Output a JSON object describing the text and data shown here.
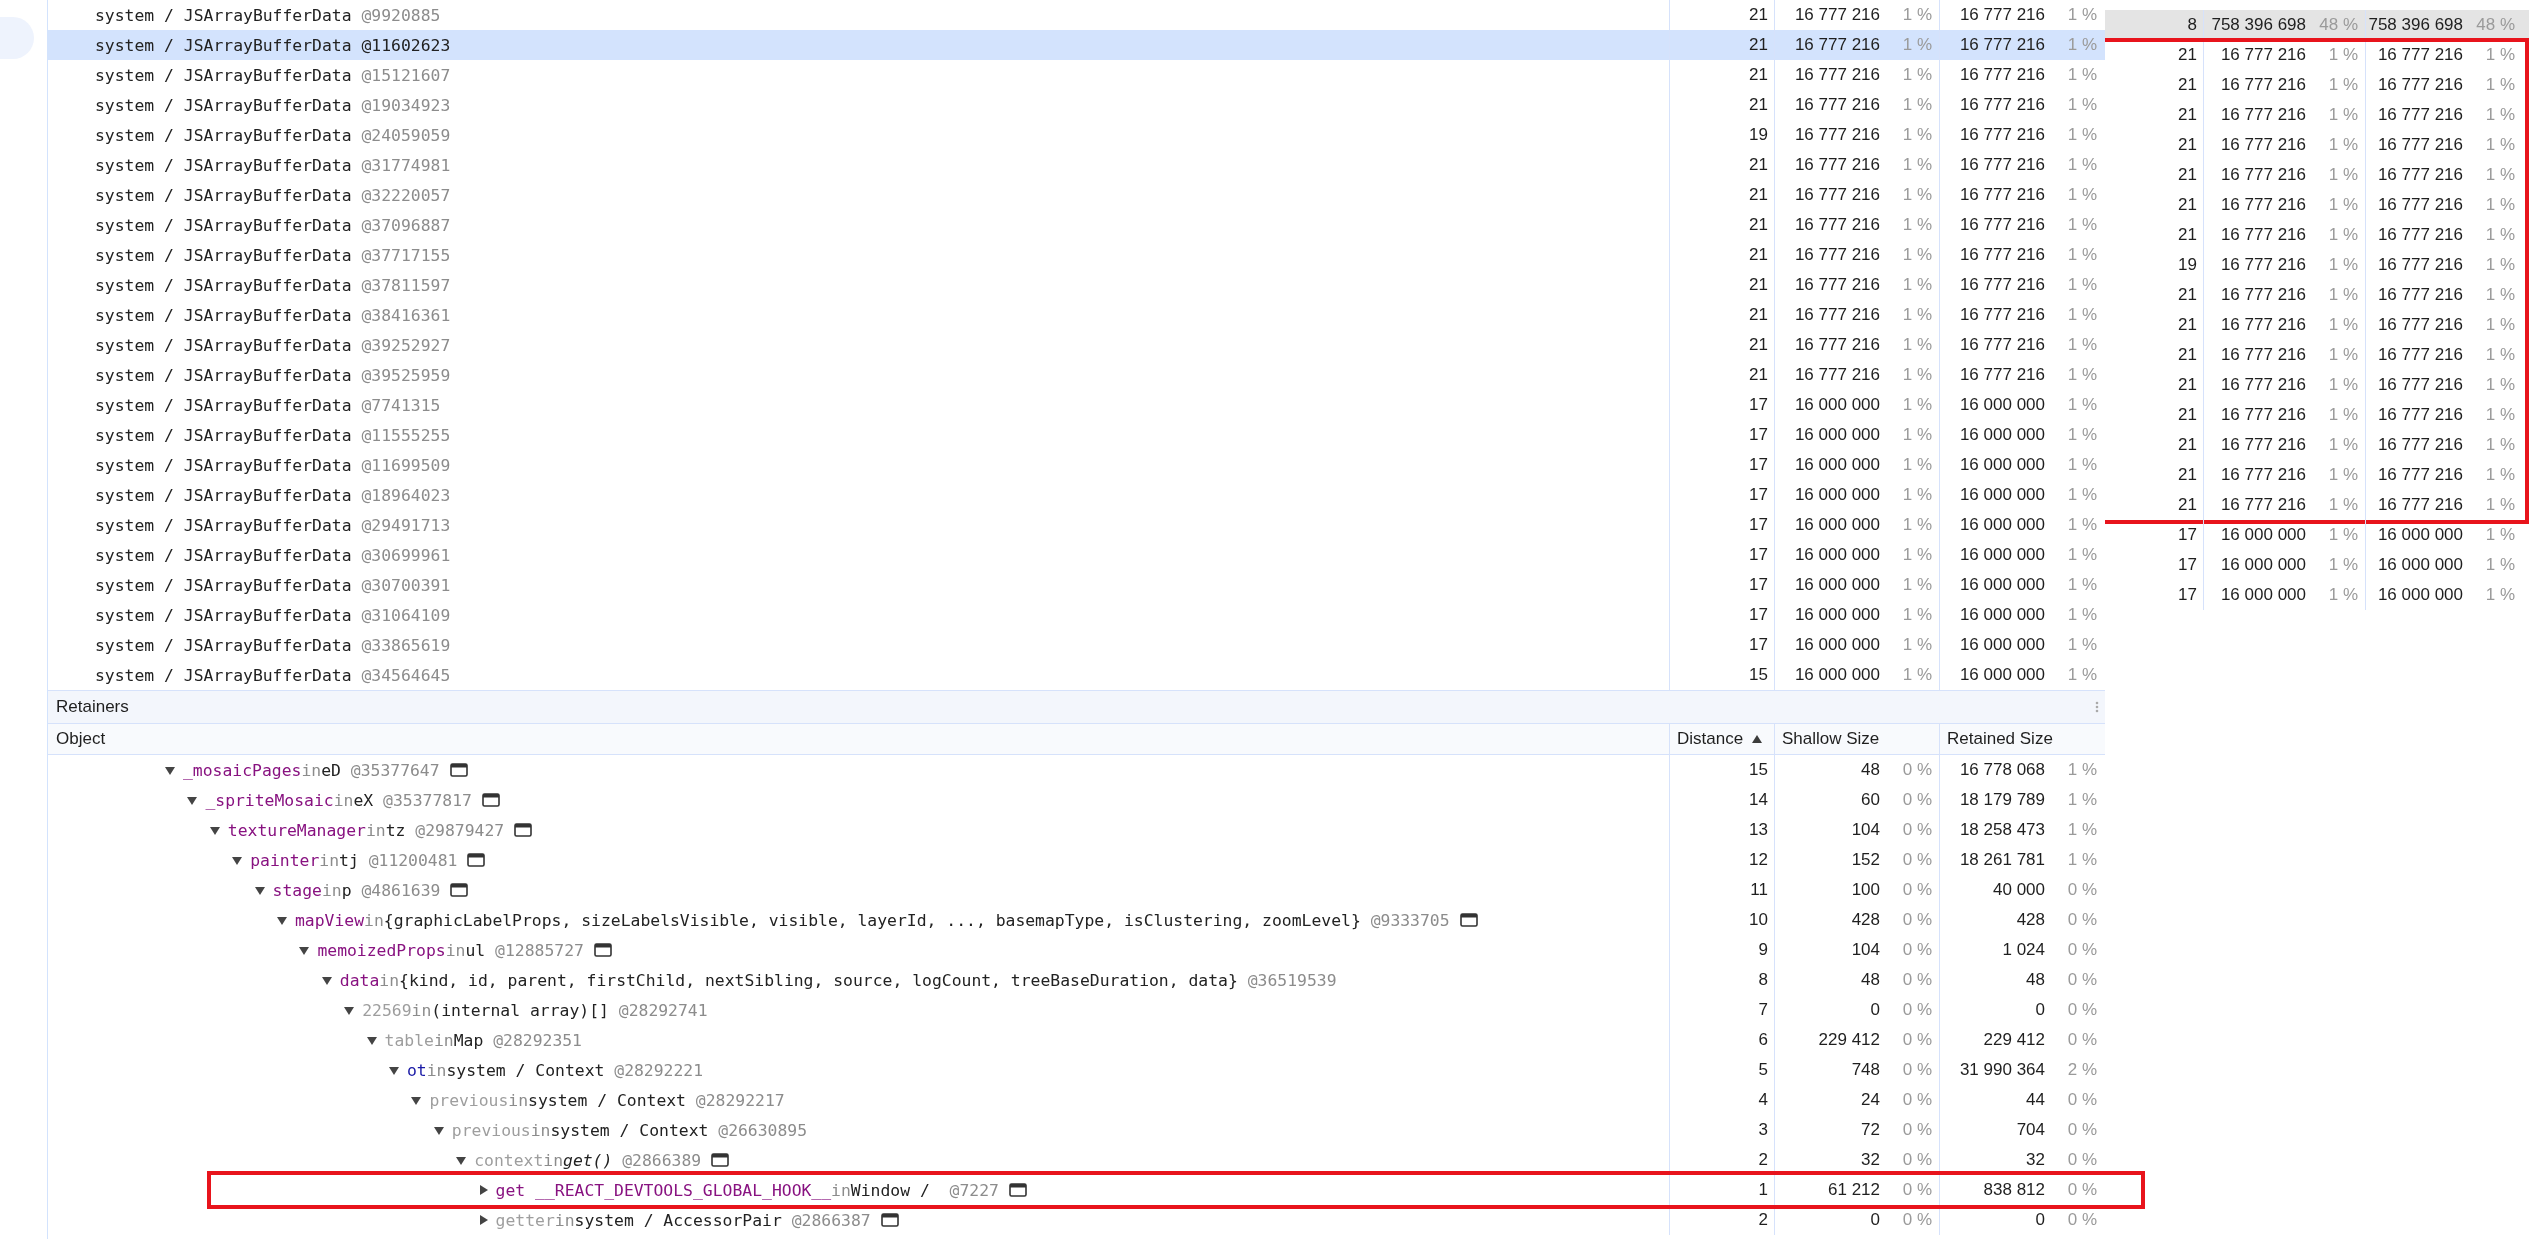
{
  "objects": {
    "rows": [
      {
        "name": "system / JSArrayBufferData",
        "id": "@9920885",
        "distance": "21",
        "shallow": "16 777 216",
        "shallow_pct": "1 %",
        "retained": "16 777 216",
        "retained_pct": "1 %",
        "selected": false
      },
      {
        "name": "system / JSArrayBufferData",
        "id": "@11602623",
        "distance": "21",
        "shallow": "16 777 216",
        "shallow_pct": "1 %",
        "retained": "16 777 216",
        "retained_pct": "1 %",
        "selected": true
      },
      {
        "name": "system / JSArrayBufferData",
        "id": "@15121607",
        "distance": "21",
        "shallow": "16 777 216",
        "shallow_pct": "1 %",
        "retained": "16 777 216",
        "retained_pct": "1 %",
        "selected": false
      },
      {
        "name": "system / JSArrayBufferData",
        "id": "@19034923",
        "distance": "21",
        "shallow": "16 777 216",
        "shallow_pct": "1 %",
        "retained": "16 777 216",
        "retained_pct": "1 %",
        "selected": false
      },
      {
        "name": "system / JSArrayBufferData",
        "id": "@24059059",
        "distance": "19",
        "shallow": "16 777 216",
        "shallow_pct": "1 %",
        "retained": "16 777 216",
        "retained_pct": "1 %",
        "selected": false
      },
      {
        "name": "system / JSArrayBufferData",
        "id": "@31774981",
        "distance": "21",
        "shallow": "16 777 216",
        "shallow_pct": "1 %",
        "retained": "16 777 216",
        "retained_pct": "1 %",
        "selected": false
      },
      {
        "name": "system / JSArrayBufferData",
        "id": "@32220057",
        "distance": "21",
        "shallow": "16 777 216",
        "shallow_pct": "1 %",
        "retained": "16 777 216",
        "retained_pct": "1 %",
        "selected": false
      },
      {
        "name": "system / JSArrayBufferData",
        "id": "@37096887",
        "distance": "21",
        "shallow": "16 777 216",
        "shallow_pct": "1 %",
        "retained": "16 777 216",
        "retained_pct": "1 %",
        "selected": false
      },
      {
        "name": "system / JSArrayBufferData",
        "id": "@37717155",
        "distance": "21",
        "shallow": "16 777 216",
        "shallow_pct": "1 %",
        "retained": "16 777 216",
        "retained_pct": "1 %",
        "selected": false
      },
      {
        "name": "system / JSArrayBufferData",
        "id": "@37811597",
        "distance": "21",
        "shallow": "16 777 216",
        "shallow_pct": "1 %",
        "retained": "16 777 216",
        "retained_pct": "1 %",
        "selected": false
      },
      {
        "name": "system / JSArrayBufferData",
        "id": "@38416361",
        "distance": "21",
        "shallow": "16 777 216",
        "shallow_pct": "1 %",
        "retained": "16 777 216",
        "retained_pct": "1 %",
        "selected": false
      },
      {
        "name": "system / JSArrayBufferData",
        "id": "@39252927",
        "distance": "21",
        "shallow": "16 777 216",
        "shallow_pct": "1 %",
        "retained": "16 777 216",
        "retained_pct": "1 %",
        "selected": false
      },
      {
        "name": "system / JSArrayBufferData",
        "id": "@39525959",
        "distance": "21",
        "shallow": "16 777 216",
        "shallow_pct": "1 %",
        "retained": "16 777 216",
        "retained_pct": "1 %",
        "selected": false
      },
      {
        "name": "system / JSArrayBufferData",
        "id": "@7741315",
        "distance": "17",
        "shallow": "16 000 000",
        "shallow_pct": "1 %",
        "retained": "16 000 000",
        "retained_pct": "1 %",
        "selected": false
      },
      {
        "name": "system / JSArrayBufferData",
        "id": "@11555255",
        "distance": "17",
        "shallow": "16 000 000",
        "shallow_pct": "1 %",
        "retained": "16 000 000",
        "retained_pct": "1 %",
        "selected": false
      },
      {
        "name": "system / JSArrayBufferData",
        "id": "@11699509",
        "distance": "17",
        "shallow": "16 000 000",
        "shallow_pct": "1 %",
        "retained": "16 000 000",
        "retained_pct": "1 %",
        "selected": false
      },
      {
        "name": "system / JSArrayBufferData",
        "id": "@18964023",
        "distance": "17",
        "shallow": "16 000 000",
        "shallow_pct": "1 %",
        "retained": "16 000 000",
        "retained_pct": "1 %",
        "selected": false
      },
      {
        "name": "system / JSArrayBufferData",
        "id": "@29491713",
        "distance": "17",
        "shallow": "16 000 000",
        "shallow_pct": "1 %",
        "retained": "16 000 000",
        "retained_pct": "1 %",
        "selected": false
      },
      {
        "name": "system / JSArrayBufferData",
        "id": "@30699961",
        "distance": "17",
        "shallow": "16 000 000",
        "shallow_pct": "1 %",
        "retained": "16 000 000",
        "retained_pct": "1 %",
        "selected": false
      },
      {
        "name": "system / JSArrayBufferData",
        "id": "@30700391",
        "distance": "17",
        "shallow": "16 000 000",
        "shallow_pct": "1 %",
        "retained": "16 000 000",
        "retained_pct": "1 %",
        "selected": false
      },
      {
        "name": "system / JSArrayBufferData",
        "id": "@31064109",
        "distance": "17",
        "shallow": "16 000 000",
        "shallow_pct": "1 %",
        "retained": "16 000 000",
        "retained_pct": "1 %",
        "selected": false
      },
      {
        "name": "system / JSArrayBufferData",
        "id": "@33865619",
        "distance": "17",
        "shallow": "16 000 000",
        "shallow_pct": "1 %",
        "retained": "16 000 000",
        "retained_pct": "1 %",
        "selected": false
      },
      {
        "name": "system / JSArrayBufferData",
        "id": "@34564645",
        "distance": "15",
        "shallow": "16 000 000",
        "shallow_pct": "1 %",
        "retained": "16 000 000",
        "retained_pct": "1 %",
        "selected": false
      }
    ]
  },
  "inset": {
    "groups": [
      {
        "framed": false,
        "rows": [
          {
            "distance": "8",
            "shallow": "758 396 698",
            "shallow_pct": "48 %",
            "retained": "758 396 698",
            "retained_pct": "48 %",
            "selected": true
          }
        ]
      },
      {
        "framed": true,
        "rows": [
          {
            "distance": "21",
            "shallow": "16 777 216",
            "shallow_pct": "1 %",
            "retained": "16 777 216",
            "retained_pct": "1 %",
            "selected": false
          },
          {
            "distance": "21",
            "shallow": "16 777 216",
            "shallow_pct": "1 %",
            "retained": "16 777 216",
            "retained_pct": "1 %",
            "selected": false
          },
          {
            "distance": "21",
            "shallow": "16 777 216",
            "shallow_pct": "1 %",
            "retained": "16 777 216",
            "retained_pct": "1 %",
            "selected": false
          },
          {
            "distance": "21",
            "shallow": "16 777 216",
            "shallow_pct": "1 %",
            "retained": "16 777 216",
            "retained_pct": "1 %",
            "selected": false
          },
          {
            "distance": "21",
            "shallow": "16 777 216",
            "shallow_pct": "1 %",
            "retained": "16 777 216",
            "retained_pct": "1 %",
            "selected": false
          },
          {
            "distance": "21",
            "shallow": "16 777 216",
            "shallow_pct": "1 %",
            "retained": "16 777 216",
            "retained_pct": "1 %",
            "selected": false
          },
          {
            "distance": "21",
            "shallow": "16 777 216",
            "shallow_pct": "1 %",
            "retained": "16 777 216",
            "retained_pct": "1 %",
            "selected": false
          },
          {
            "distance": "19",
            "shallow": "16 777 216",
            "shallow_pct": "1 %",
            "retained": "16 777 216",
            "retained_pct": "1 %",
            "selected": false
          },
          {
            "distance": "21",
            "shallow": "16 777 216",
            "shallow_pct": "1 %",
            "retained": "16 777 216",
            "retained_pct": "1 %",
            "selected": false
          },
          {
            "distance": "21",
            "shallow": "16 777 216",
            "shallow_pct": "1 %",
            "retained": "16 777 216",
            "retained_pct": "1 %",
            "selected": false
          },
          {
            "distance": "21",
            "shallow": "16 777 216",
            "shallow_pct": "1 %",
            "retained": "16 777 216",
            "retained_pct": "1 %",
            "selected": false
          },
          {
            "distance": "21",
            "shallow": "16 777 216",
            "shallow_pct": "1 %",
            "retained": "16 777 216",
            "retained_pct": "1 %",
            "selected": false
          },
          {
            "distance": "21",
            "shallow": "16 777 216",
            "shallow_pct": "1 %",
            "retained": "16 777 216",
            "retained_pct": "1 %",
            "selected": false
          },
          {
            "distance": "21",
            "shallow": "16 777 216",
            "shallow_pct": "1 %",
            "retained": "16 777 216",
            "retained_pct": "1 %",
            "selected": false
          },
          {
            "distance": "21",
            "shallow": "16 777 216",
            "shallow_pct": "1 %",
            "retained": "16 777 216",
            "retained_pct": "1 %",
            "selected": false
          },
          {
            "distance": "21",
            "shallow": "16 777 216",
            "shallow_pct": "1 %",
            "retained": "16 777 216",
            "retained_pct": "1 %",
            "selected": false
          }
        ]
      },
      {
        "framed": false,
        "rows": [
          {
            "distance": "17",
            "shallow": "16 000 000",
            "shallow_pct": "1 %",
            "retained": "16 000 000",
            "retained_pct": "1 %",
            "selected": false
          },
          {
            "distance": "17",
            "shallow": "16 000 000",
            "shallow_pct": "1 %",
            "retained": "16 000 000",
            "retained_pct": "1 %",
            "selected": false
          },
          {
            "distance": "17",
            "shallow": "16 000 000",
            "shallow_pct": "1 %",
            "retained": "16 000 000",
            "retained_pct": "1 %",
            "selected": false
          }
        ]
      }
    ]
  },
  "retainers": {
    "title": "Retainers",
    "columns": [
      {
        "label": "Object",
        "sorted": false
      },
      {
        "label": "Distance",
        "sorted": true
      },
      {
        "label": "Shallow Size",
        "sorted": false
      },
      {
        "label": "Retained Size",
        "sorted": false
      }
    ],
    "rows": [
      {
        "name": "_mosaicPages",
        "kind": "property",
        "owner": "eD",
        "id": "@35377647",
        "link": "in",
        "icon": true,
        "expanded": true,
        "framed": false,
        "distance": "15",
        "shallow": "48",
        "shallow_pct": "0 %",
        "retained": "16 778 068",
        "retained_pct": "1 %",
        "children": [
          {
            "name": "_spriteMosaic",
            "kind": "property",
            "owner": "eX",
            "id": "@35377817",
            "link": "in",
            "icon": true,
            "expanded": true,
            "framed": false,
            "distance": "14",
            "shallow": "60",
            "shallow_pct": "0 %",
            "retained": "18 179 789",
            "retained_pct": "1 %",
            "children": [
              {
                "name": "textureManager",
                "kind": "property",
                "owner": "tz",
                "id": "@29879427",
                "link": "in",
                "icon": true,
                "expanded": true,
                "framed": false,
                "distance": "13",
                "shallow": "104",
                "shallow_pct": "0 %",
                "retained": "18 258 473",
                "retained_pct": "1 %",
                "children": [
                  {
                    "name": "painter",
                    "kind": "property",
                    "owner": "tj",
                    "id": "@11200481",
                    "link": "in",
                    "icon": true,
                    "expanded": true,
                    "framed": false,
                    "distance": "12",
                    "shallow": "152",
                    "shallow_pct": "0 %",
                    "retained": "18 261 781",
                    "retained_pct": "1 %",
                    "children": [
                      {
                        "name": "stage",
                        "kind": "property",
                        "owner": "p",
                        "id": "@4861639",
                        "link": "in",
                        "icon": true,
                        "expanded": true,
                        "framed": false,
                        "distance": "11",
                        "shallow": "100",
                        "shallow_pct": "0 %",
                        "retained": "40 000",
                        "retained_pct": "0 %",
                        "children": [
                          {
                            "name": "mapView",
                            "kind": "property",
                            "owner": "{graphicLabelProps, sizeLabelsVisible, visible, layerId, ..., basemapType, isClustering, zoomLevel}",
                            "id": "@9333705",
                            "link": "in",
                            "icon": true,
                            "expanded": true,
                            "framed": false,
                            "distance": "10",
                            "shallow": "428",
                            "shallow_pct": "0 %",
                            "retained": "428",
                            "retained_pct": "0 %",
                            "children": [
                              {
                                "name": "memoizedProps",
                                "kind": "property",
                                "owner": "ul",
                                "id": "@12885727",
                                "link": "in",
                                "icon": true,
                                "expanded": true,
                                "framed": false,
                                "distance": "9",
                                "shallow": "104",
                                "shallow_pct": "0 %",
                                "retained": "1 024",
                                "retained_pct": "0 %",
                                "children": [
                                  {
                                    "name": "data",
                                    "kind": "property",
                                    "owner": "{kind, id, parent, firstChild, nextSibling, source, logCount, treeBaseDuration, data}",
                                    "id": "@36519539",
                                    "link": "in",
                                    "icon": false,
                                    "expanded": true,
                                    "framed": false,
                                    "distance": "8",
                                    "shallow": "48",
                                    "shallow_pct": "0 %",
                                    "retained": "48",
                                    "retained_pct": "0 %",
                                    "children": [
                                      {
                                        "name": "22569",
                                        "kind": "internal",
                                        "owner": "(internal array)[]",
                                        "id": "@28292741",
                                        "link": "in",
                                        "icon": false,
                                        "expanded": true,
                                        "framed": false,
                                        "distance": "7",
                                        "shallow": "0",
                                        "shallow_pct": "0 %",
                                        "retained": "0",
                                        "retained_pct": "0 %",
                                        "children": [
                                          {
                                            "name": "table",
                                            "kind": "internal",
                                            "owner": "Map",
                                            "id": "@28292351",
                                            "link": "in",
                                            "icon": false,
                                            "expanded": true,
                                            "framed": false,
                                            "distance": "6",
                                            "shallow": "229 412",
                                            "shallow_pct": "0 %",
                                            "retained": "229 412",
                                            "retained_pct": "0 %",
                                            "children": [
                                              {
                                                "name": "ot",
                                                "kind": "variable",
                                                "owner": "system / Context",
                                                "id": "@28292221",
                                                "link": "in",
                                                "icon": false,
                                                "expanded": true,
                                                "framed": false,
                                                "distance": "5",
                                                "shallow": "748",
                                                "shallow_pct": "0 %",
                                                "retained": "31 990 364",
                                                "retained_pct": "2 %",
                                                "children": [
                                                  {
                                                    "name": "previous",
                                                    "kind": "internal",
                                                    "owner": "system / Context",
                                                    "id": "@28292217",
                                                    "link": "in",
                                                    "icon": false,
                                                    "expanded": true,
                                                    "framed": false,
                                                    "distance": "4",
                                                    "shallow": "24",
                                                    "shallow_pct": "0 %",
                                                    "retained": "44",
                                                    "retained_pct": "0 %",
                                                    "children": [
                                                      {
                                                        "name": "previous",
                                                        "kind": "internal",
                                                        "owner": "system / Context",
                                                        "id": "@26630895",
                                                        "link": "in",
                                                        "icon": false,
                                                        "expanded": true,
                                                        "framed": false,
                                                        "distance": "3",
                                                        "shallow": "72",
                                                        "shallow_pct": "0 %",
                                                        "retained": "704",
                                                        "retained_pct": "0 %",
                                                        "children": [
                                                          {
                                                            "name": "context",
                                                            "kind": "internal",
                                                            "owner": "*get()*",
                                                            "id": "@2866389",
                                                            "link": "in",
                                                            "icon": true,
                                                            "expanded": true,
                                                            "framed": false,
                                                            "distance": "2",
                                                            "shallow": "32",
                                                            "shallow_pct": "0 %",
                                                            "retained": "32",
                                                            "retained_pct": "0 %",
                                                            "children": [
                                                              {
                                                                "name": "get __REACT_DEVTOOLS_GLOBAL_HOOK__",
                                                                "kind": "property",
                                                                "owner": "Window / ",
                                                                "id": "@7227",
                                                                "link": "in",
                                                                "icon": true,
                                                                "expanded": false,
                                                                "framed": true,
                                                                "distance": "1",
                                                                "shallow": "61 212",
                                                                "shallow_pct": "0 %",
                                                                "retained": "838 812",
                                                                "retained_pct": "0 %"
                                                              },
                                                              {
                                                                "name": "getter",
                                                                "kind": "internal",
                                                                "owner": "system / AccessorPair",
                                                                "id": "@2866387",
                                                                "link": "in",
                                                                "icon": true,
                                                                "expanded": false,
                                                                "framed": false,
                                                                "distance": "2",
                                                                "shallow": "0",
                                                                "shallow_pct": "0 %",
                                                                "retained": "0",
                                                                "retained_pct": "0 %"
                                                              }
                                                            ]
                                                          }
                                                        ]
                                                      }
                                                    ]
                                                  }
                                                ]
                                              }
                                            ]
                                          }
                                        ]
                                      }
                                    ]
                                  }
                                ]
                              }
                            ]
                          }
                        ]
                      }
                    ]
                  }
                ]
              }
            ]
          }
        ]
      }
    ]
  }
}
